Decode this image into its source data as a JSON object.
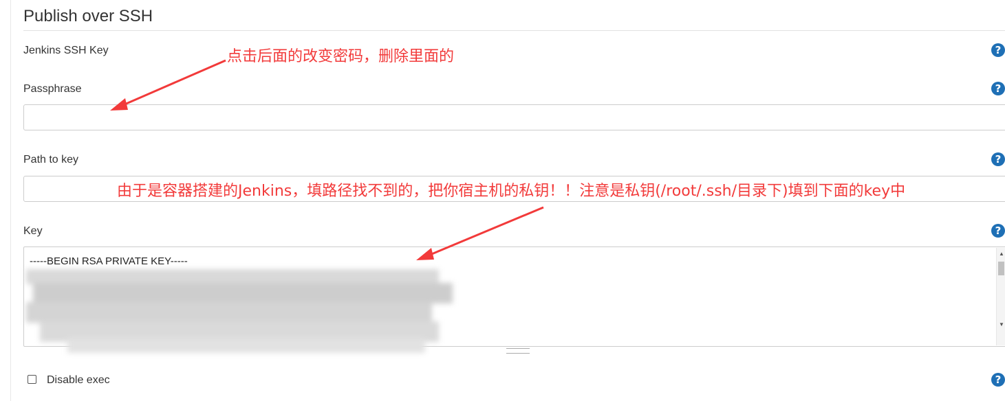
{
  "section": {
    "title": "Publish over SSH"
  },
  "fields": {
    "jenkins_ssh_key_label": "Jenkins SSH Key",
    "passphrase_label": "Passphrase",
    "passphrase_value": "",
    "path_to_key_label": "Path to key",
    "path_to_key_value": "",
    "key_label": "Key",
    "key_value_first_line": "-----BEGIN RSA PRIVATE KEY-----",
    "disable_exec_label": "Disable exec",
    "disable_exec_checked": false
  },
  "help_icon_label": "?",
  "annotations": {
    "top": "点击后面的改变密码，删除里面的",
    "middle": "由于是容器搭建的Jenkins，填路径找不到的，把你宿主机的私钥！！注意是私钥(/root/.ssh/目录下)填到下面的key中"
  },
  "colors": {
    "annotation": "#f23a3a",
    "help_icon": "#1e6fb5"
  }
}
